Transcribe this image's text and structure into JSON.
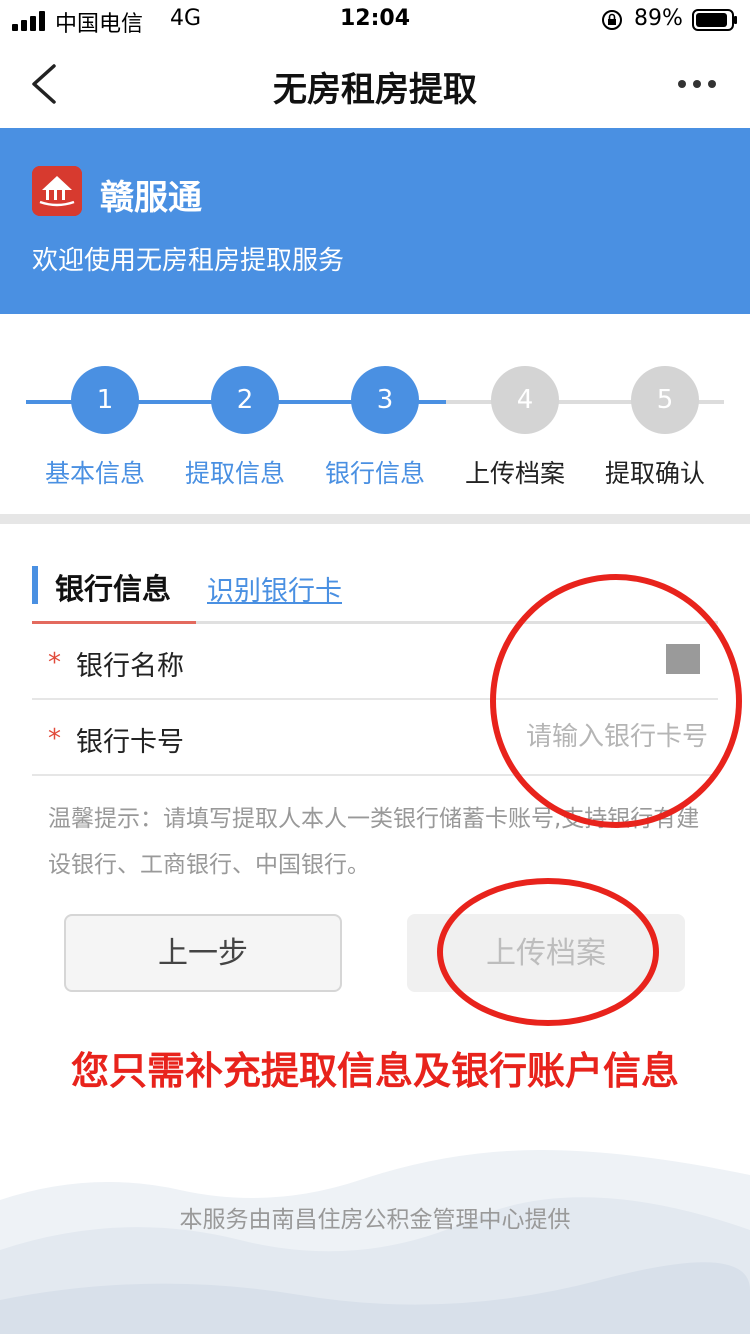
{
  "status_bar": {
    "carrier": "中国电信",
    "network": "4G",
    "time": "12:04",
    "battery": "89%"
  },
  "nav": {
    "title": "无房租房提取"
  },
  "banner": {
    "app_name": "赣服通",
    "welcome": "欢迎使用无房租房提取服务",
    "background_color": "#4a90e2"
  },
  "steps": [
    {
      "number": "1",
      "label": "基本信息",
      "state": "done"
    },
    {
      "number": "2",
      "label": "提取信息",
      "state": "done"
    },
    {
      "number": "3",
      "label": "银行信息",
      "state": "current"
    },
    {
      "number": "4",
      "label": "上传档案",
      "state": "todo"
    },
    {
      "number": "5",
      "label": "提取确认",
      "state": "todo"
    }
  ],
  "form": {
    "section_title": "银行信息",
    "recognize_link": "识别银行卡",
    "required_mark": "*",
    "bank_name": {
      "label": "银行名称"
    },
    "card_number": {
      "label": "银行卡号",
      "placeholder": "请输入银行卡号"
    },
    "tip": "温馨提示：请填写提取人本人一类银行储蓄卡账号,支持银行有建设银行、工商银行、中国银行。"
  },
  "buttons": {
    "prev": "上一步",
    "next": "上传档案"
  },
  "annotation": {
    "text": "您只需补充提取信息及银行账户信息",
    "color": "#e8231c"
  },
  "footer": {
    "text": "本服务由南昌住房公积金管理中心提供"
  }
}
